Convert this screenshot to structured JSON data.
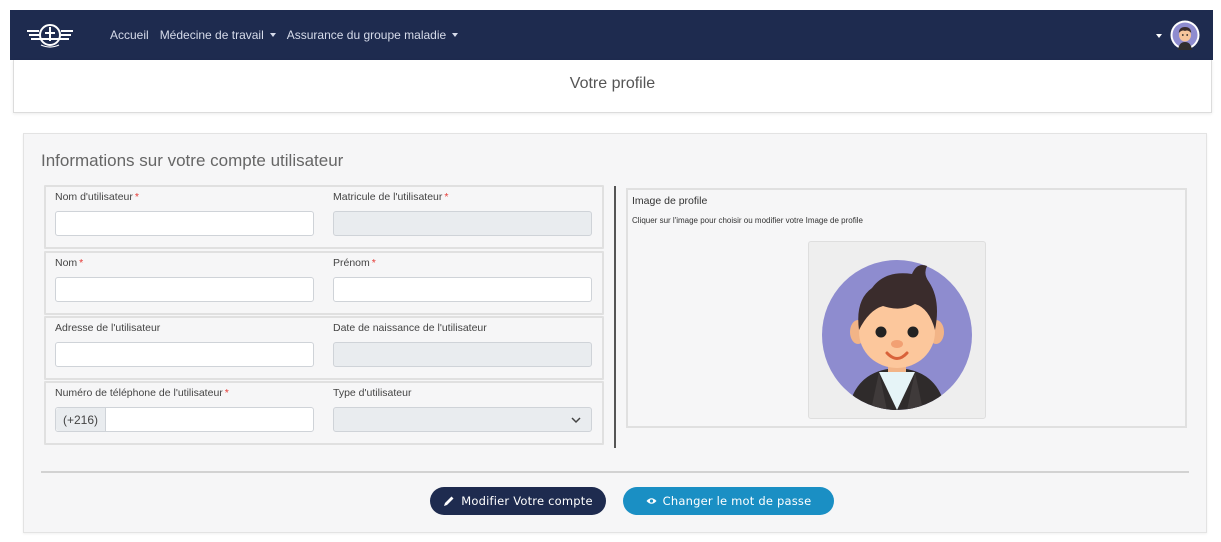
{
  "navbar": {
    "links": [
      {
        "label": "Accueil",
        "dropdown": false
      },
      {
        "label": "Médecine de travail",
        "dropdown": true
      },
      {
        "label": "Assurance du groupe maladie",
        "dropdown": true
      }
    ],
    "background_color": "#1e2b4f"
  },
  "page": {
    "title": "Votre profile"
  },
  "form": {
    "heading": "Informations sur votre compte utilisateur",
    "fields": {
      "username": {
        "label": "Nom d'utilisateur",
        "required": "*",
        "value": ""
      },
      "matricule": {
        "label": "Matricule de l'utilisateur",
        "required": "*",
        "value": ""
      },
      "nom": {
        "label": "Nom",
        "required": "*",
        "value": ""
      },
      "prenom": {
        "label": "Prénom",
        "required": "*",
        "value": ""
      },
      "adresse": {
        "label": "Adresse de l'utilisateur",
        "value": ""
      },
      "date_naissance": {
        "label": "Date de naissance de l'utilisateur",
        "value": ""
      },
      "telephone": {
        "label": "Numéro de téléphone de l'utilisateur",
        "required": "*",
        "prefix": "(+216)",
        "value": ""
      },
      "type": {
        "label": "Type d'utilisateur",
        "value": ""
      }
    }
  },
  "profile_image": {
    "title": "Image de profile",
    "hint": "Cliquer sur l'image pour choisir ou modifier votre Image de profile"
  },
  "buttons": {
    "modify": "Modifier Votre compte",
    "password": "Changer le mot de passe"
  },
  "icons": {
    "logo": "company-logo-icon",
    "modify": "pencil-icon",
    "password": "eye-icon",
    "select": "chevron-down-icon"
  },
  "colors": {
    "primary_dark": "#1e2b4f",
    "info": "#1a8fc4",
    "required": "#e53935"
  }
}
